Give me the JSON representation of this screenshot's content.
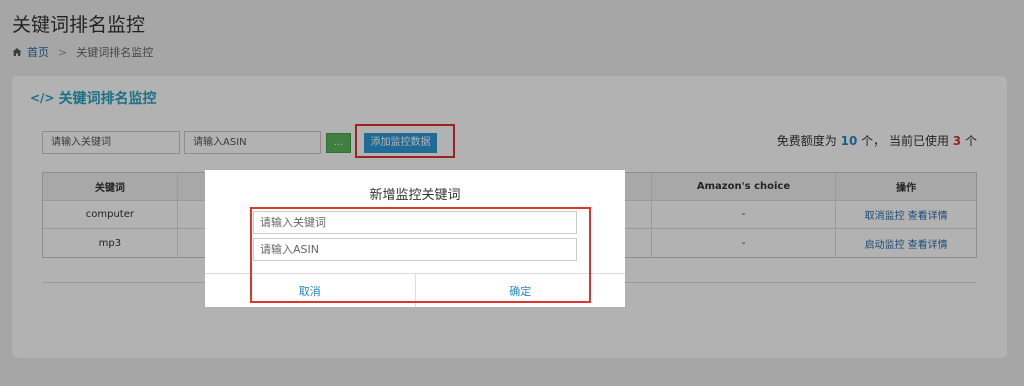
{
  "page": {
    "title": "关键词排名监控",
    "breadcrumb": {
      "home": "首页",
      "separator": ">",
      "current": "关键词排名监控"
    }
  },
  "panel": {
    "title": "关键词排名监控",
    "title_icon": "</>",
    "keyword_placeholder": "请输入关键词",
    "asin_placeholder": "请输入ASIN",
    "ellipsis_label": "...",
    "add_label": "添加监控数据",
    "quota": {
      "prefix": "免费额度为",
      "free": "10",
      "middle": "个，  当前已使用",
      "used": "3",
      "suffix": "个"
    }
  },
  "table": {
    "headers": [
      "关键词",
      "",
      "Amazon's choice",
      "操作"
    ],
    "rows": [
      {
        "keyword": "computer",
        "choice": "-",
        "action1": "取消监控",
        "action2": "查看详情"
      },
      {
        "keyword": "mp3",
        "choice": "-",
        "action1": "启动监控",
        "action2": "查看详情"
      }
    ]
  },
  "modal": {
    "title": "新增监控关键词",
    "keyword_placeholder": "请输入关键词",
    "asin_placeholder": "请输入ASIN",
    "cancel_label": "取消",
    "confirm_label": "确定"
  },
  "colors": {
    "accent": "#2aa3c0",
    "link": "#2a87c8",
    "highlight": "#e0342c",
    "add_button": "#2f9ad6",
    "green_button": "#5bb75b"
  }
}
